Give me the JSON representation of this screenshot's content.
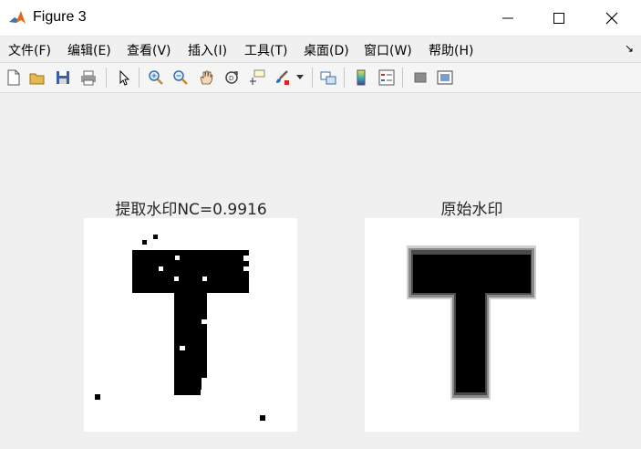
{
  "window": {
    "title": "Figure 3"
  },
  "menu": [
    "文件(F)",
    "编辑(E)",
    "查看(V)",
    "插入(I)",
    "工具(T)",
    "桌面(D)",
    "窗口(W)",
    "帮助(H)"
  ],
  "toolbar": {
    "icons": [
      "new-figure-icon",
      "open-file-icon",
      "save-icon",
      "print-icon",
      "pointer-icon",
      "zoom-in-icon",
      "zoom-out-icon",
      "pan-icon",
      "rotate-3d-icon",
      "data-cursor-icon",
      "brush-icon",
      "link-plot-icon",
      "colorbar-icon",
      "legend-icon",
      "hide-plot-tools-icon",
      "show-plot-tools-icon"
    ]
  },
  "plots": [
    {
      "title": "提取水印NC=0.9916",
      "image": "extracted-watermark-T"
    },
    {
      "title": "原始水印",
      "image": "original-watermark-T"
    }
  ]
}
